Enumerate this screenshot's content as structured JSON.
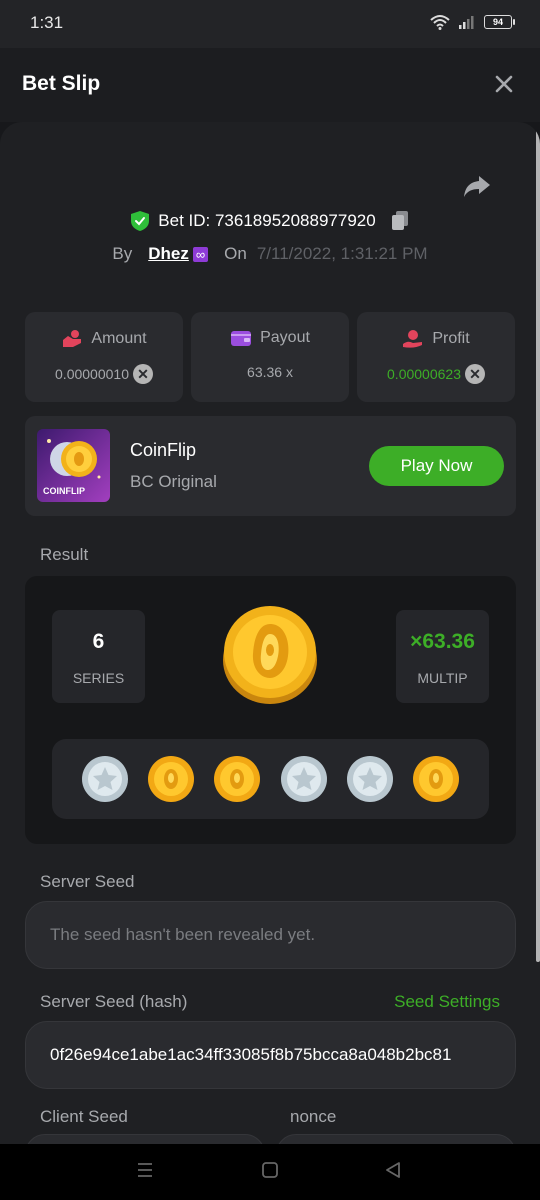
{
  "status": {
    "time": "1:31",
    "battery": "94"
  },
  "header": {
    "title": "Bet Slip"
  },
  "bet": {
    "id_label": "Bet ID: 73618952088977920",
    "by_label": "By",
    "user": "Dhez",
    "user_badge": "∞",
    "on_label": "On",
    "date": "7/11/2022, 1:31:21 PM"
  },
  "stats": {
    "amount_label": "Amount",
    "amount_value": "0.00000010",
    "payout_label": "Payout",
    "payout_value": "63.36 x",
    "profit_label": "Profit",
    "profit_value": "0.00000623"
  },
  "game": {
    "name": "CoinFlip",
    "provider": "BC Original",
    "thumb_text": "COINFLIP",
    "play_label": "Play Now"
  },
  "result": {
    "label": "Result",
    "series_value": "6",
    "series_label": "SERIES",
    "multiplier_value": "×63.36",
    "multiplier_label": "MULTIP",
    "coins": [
      "silver",
      "gold",
      "gold",
      "silver",
      "silver",
      "gold"
    ]
  },
  "server_seed": {
    "label": "Server Seed",
    "value": "The seed hasn't been revealed yet."
  },
  "server_seed_hash": {
    "label": "Server Seed (hash)",
    "settings_label": "Seed Settings",
    "value": "0f26e94ce1abe1ac34ff33085f8b75bcca8a048b2bc81"
  },
  "client_seed": {
    "label": "Client Seed"
  },
  "nonce": {
    "label": "nonce"
  },
  "colors": {
    "accent_green": "#3dae27",
    "shield_green": "#2fbf3a",
    "background": "#17181b",
    "card": "#2a2b2f"
  }
}
